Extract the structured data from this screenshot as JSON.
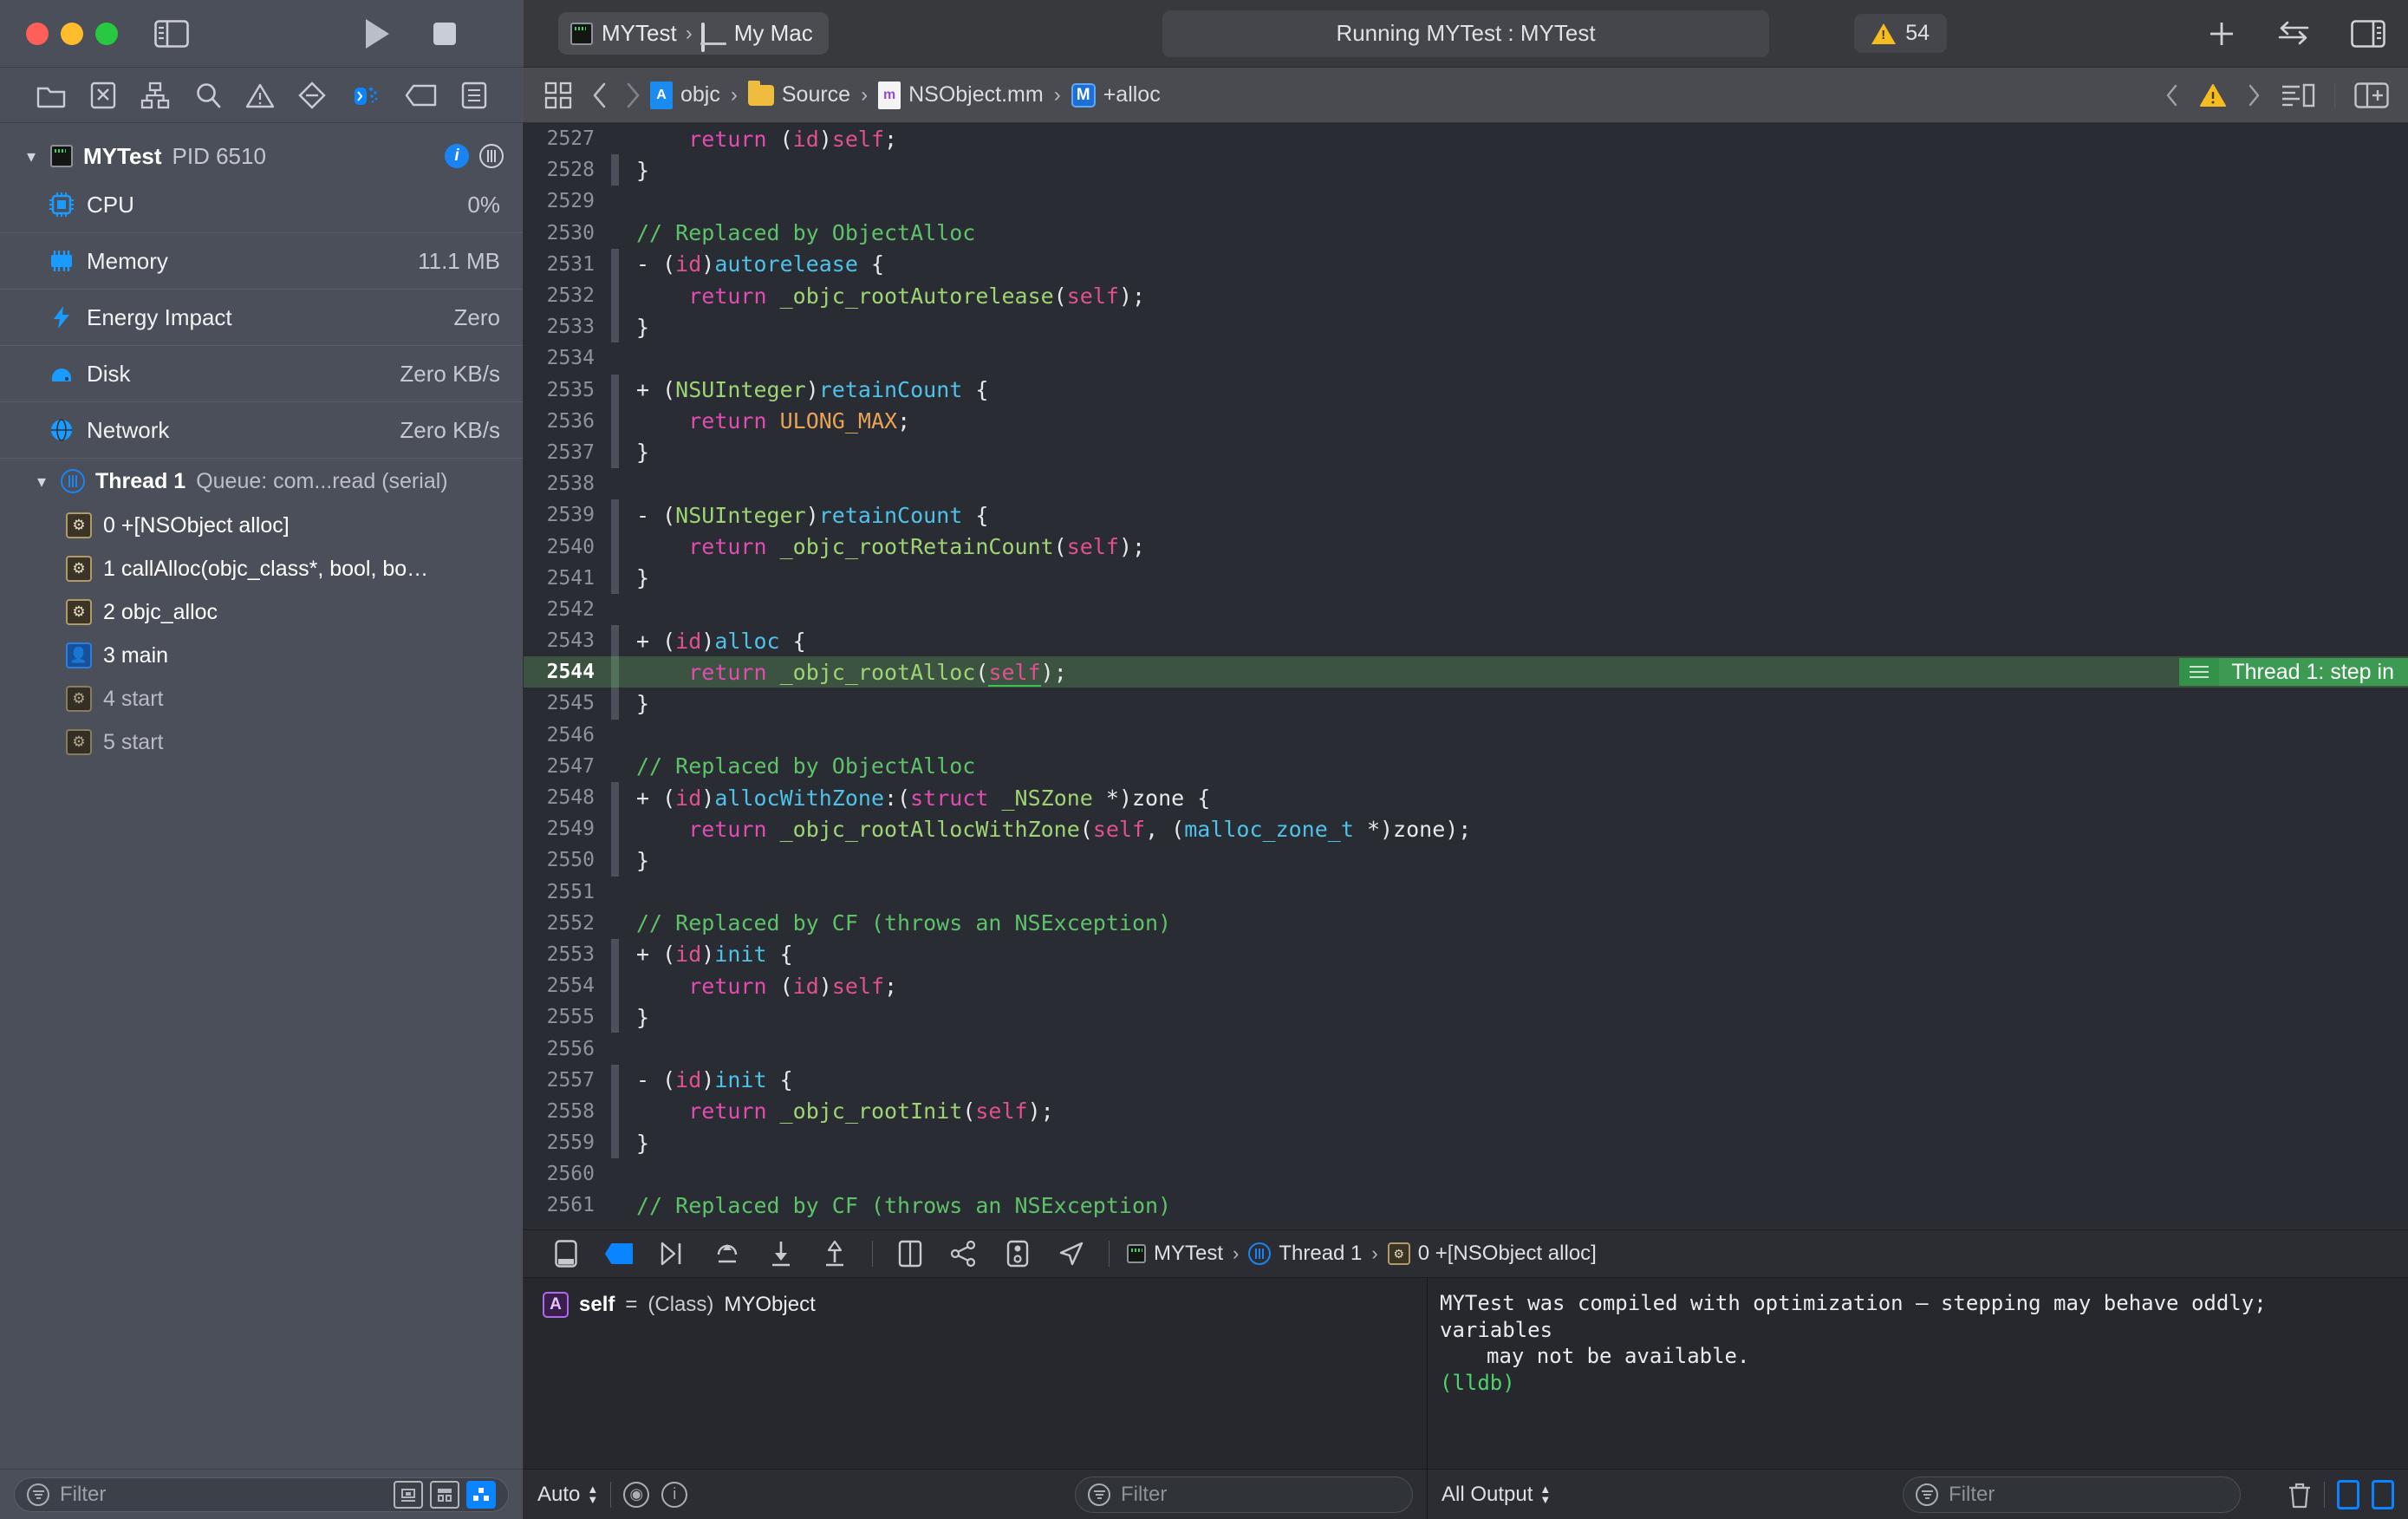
{
  "window": {
    "traffic_lights": [
      "close",
      "minimize",
      "zoom"
    ],
    "run_button": "run-icon",
    "stop_button": "stop-icon"
  },
  "scheme": {
    "target": "MYTest",
    "separator": "›",
    "destination": "My Mac"
  },
  "status": {
    "text": "Running MYTest : MYTest",
    "warning_count": "54"
  },
  "toolbar_right": {
    "add": "plus-icon",
    "navigate": "swap-icon",
    "inspector": "inspector-toggle-icon"
  },
  "navigator_toolbar": {
    "items": [
      {
        "name": "folder-icon",
        "label": "Project navigator"
      },
      {
        "name": "source-control-icon",
        "label": "Source control navigator"
      },
      {
        "name": "hierarchy-icon",
        "label": "Symbol navigator"
      },
      {
        "name": "search-icon",
        "label": "Find navigator"
      },
      {
        "name": "warning-icon",
        "label": "Issue navigator"
      },
      {
        "name": "test-icon",
        "label": "Test navigator"
      },
      {
        "name": "debug-icon",
        "label": "Debug navigator"
      },
      {
        "name": "breakpoint-icon",
        "label": "Breakpoint navigator"
      },
      {
        "name": "report-icon",
        "label": "Report navigator"
      }
    ]
  },
  "jump_bar": {
    "separator": "›",
    "crumbs": [
      {
        "label": "objc",
        "icon": "project-icon"
      },
      {
        "label": "Source",
        "icon": "folder-icon"
      },
      {
        "label": "NSObject.mm",
        "icon": "objcpp-file-icon"
      },
      {
        "label": "+alloc",
        "icon": "method-badge-icon"
      }
    ]
  },
  "debug_navigator": {
    "process": {
      "name": "MYTest",
      "pid": "PID 6510"
    },
    "gauges": [
      {
        "label": "CPU",
        "value": "0%",
        "icon": "cpu-icon"
      },
      {
        "label": "Memory",
        "value": "11.1 MB",
        "icon": "memory-icon"
      },
      {
        "label": "Energy Impact",
        "value": "Zero",
        "icon": "energy-icon"
      },
      {
        "label": "Disk",
        "value": "Zero KB/s",
        "icon": "disk-icon"
      },
      {
        "label": "Network",
        "value": "Zero KB/s",
        "icon": "network-icon"
      }
    ],
    "thread": {
      "name": "Thread 1",
      "queue": "Queue: com...read (serial)"
    },
    "frames": [
      {
        "label": "0 +[NSObject alloc]",
        "kind": "system",
        "dim": false
      },
      {
        "label": "1 callAlloc(objc_class*, bool, bo…",
        "kind": "system",
        "dim": false
      },
      {
        "label": "2 objc_alloc",
        "kind": "system",
        "dim": false
      },
      {
        "label": "3 main",
        "kind": "user",
        "dim": false
      },
      {
        "label": "4 start",
        "kind": "system",
        "dim": true
      },
      {
        "label": "5 start",
        "kind": "system",
        "dim": true
      }
    ],
    "filter_placeholder": "Filter"
  },
  "editor": {
    "highlight_line": 2544,
    "step_badge": "Thread 1: step in",
    "lines": [
      {
        "n": 2527,
        "mark": false,
        "tokens": [
          {
            "t": "    ",
            "c": "plain"
          },
          {
            "t": "return",
            "c": "kw"
          },
          {
            "t": " (",
            "c": "plain"
          },
          {
            "t": "id",
            "c": "self"
          },
          {
            "t": ")",
            "c": "plain"
          },
          {
            "t": "self",
            "c": "self"
          },
          {
            "t": ";",
            "c": "plain"
          }
        ]
      },
      {
        "n": 2528,
        "mark": true,
        "tokens": [
          {
            "t": "}",
            "c": "plain"
          }
        ]
      },
      {
        "n": 2529,
        "mark": false,
        "tokens": []
      },
      {
        "n": 2530,
        "mark": false,
        "tokens": [
          {
            "t": "// Replaced by ObjectAlloc",
            "c": "cmt"
          }
        ]
      },
      {
        "n": 2531,
        "mark": true,
        "tokens": [
          {
            "t": "- (",
            "c": "plain"
          },
          {
            "t": "id",
            "c": "self"
          },
          {
            "t": ")",
            "c": "plain"
          },
          {
            "t": "autorelease",
            "c": "meth"
          },
          {
            "t": " {",
            "c": "plain"
          }
        ]
      },
      {
        "n": 2532,
        "mark": true,
        "tokens": [
          {
            "t": "    ",
            "c": "plain"
          },
          {
            "t": "return",
            "c": "kw"
          },
          {
            "t": " ",
            "c": "plain"
          },
          {
            "t": "_objc_rootAutorelease",
            "c": "fn"
          },
          {
            "t": "(",
            "c": "plain"
          },
          {
            "t": "self",
            "c": "self"
          },
          {
            "t": ");",
            "c": "plain"
          }
        ]
      },
      {
        "n": 2533,
        "mark": true,
        "tokens": [
          {
            "t": "}",
            "c": "plain"
          }
        ]
      },
      {
        "n": 2534,
        "mark": false,
        "tokens": []
      },
      {
        "n": 2535,
        "mark": true,
        "tokens": [
          {
            "t": "+ (",
            "c": "plain"
          },
          {
            "t": "NSUInteger",
            "c": "type"
          },
          {
            "t": ")",
            "c": "plain"
          },
          {
            "t": "retainCount",
            "c": "meth"
          },
          {
            "t": " {",
            "c": "plain"
          }
        ]
      },
      {
        "n": 2536,
        "mark": true,
        "tokens": [
          {
            "t": "    ",
            "c": "plain"
          },
          {
            "t": "return",
            "c": "kw"
          },
          {
            "t": " ",
            "c": "plain"
          },
          {
            "t": "ULONG_MAX",
            "c": "macro"
          },
          {
            "t": ";",
            "c": "plain"
          }
        ]
      },
      {
        "n": 2537,
        "mark": true,
        "tokens": [
          {
            "t": "}",
            "c": "plain"
          }
        ]
      },
      {
        "n": 2538,
        "mark": false,
        "tokens": []
      },
      {
        "n": 2539,
        "mark": true,
        "tokens": [
          {
            "t": "- (",
            "c": "plain"
          },
          {
            "t": "NSUInteger",
            "c": "type"
          },
          {
            "t": ")",
            "c": "plain"
          },
          {
            "t": "retainCount",
            "c": "meth"
          },
          {
            "t": " {",
            "c": "plain"
          }
        ]
      },
      {
        "n": 2540,
        "mark": true,
        "tokens": [
          {
            "t": "    ",
            "c": "plain"
          },
          {
            "t": "return",
            "c": "kw"
          },
          {
            "t": " ",
            "c": "plain"
          },
          {
            "t": "_objc_rootRetainCount",
            "c": "fn"
          },
          {
            "t": "(",
            "c": "plain"
          },
          {
            "t": "self",
            "c": "self"
          },
          {
            "t": ");",
            "c": "plain"
          }
        ]
      },
      {
        "n": 2541,
        "mark": true,
        "tokens": [
          {
            "t": "}",
            "c": "plain"
          }
        ]
      },
      {
        "n": 2542,
        "mark": false,
        "tokens": []
      },
      {
        "n": 2543,
        "mark": true,
        "tokens": [
          {
            "t": "+ (",
            "c": "plain"
          },
          {
            "t": "id",
            "c": "self"
          },
          {
            "t": ")",
            "c": "plain"
          },
          {
            "t": "alloc",
            "c": "meth"
          },
          {
            "t": " {",
            "c": "plain"
          }
        ]
      },
      {
        "n": 2544,
        "mark": true,
        "tokens": [
          {
            "t": "    ",
            "c": "plain"
          },
          {
            "t": "return",
            "c": "kw"
          },
          {
            "t": " ",
            "c": "plain"
          },
          {
            "t": "_objc_rootAlloc",
            "c": "fn"
          },
          {
            "t": "(",
            "c": "plain"
          },
          {
            "t": "self",
            "c": "uself"
          },
          {
            "t": ");",
            "c": "plain"
          }
        ]
      },
      {
        "n": 2545,
        "mark": true,
        "tokens": [
          {
            "t": "}",
            "c": "plain"
          }
        ]
      },
      {
        "n": 2546,
        "mark": false,
        "tokens": []
      },
      {
        "n": 2547,
        "mark": false,
        "tokens": [
          {
            "t": "// Replaced by ObjectAlloc",
            "c": "cmt"
          }
        ]
      },
      {
        "n": 2548,
        "mark": true,
        "tokens": [
          {
            "t": "+ (",
            "c": "plain"
          },
          {
            "t": "id",
            "c": "self"
          },
          {
            "t": ")",
            "c": "plain"
          },
          {
            "t": "allocWithZone",
            "c": "meth"
          },
          {
            "t": ":(",
            "c": "plain"
          },
          {
            "t": "struct",
            "c": "kw"
          },
          {
            "t": " ",
            "c": "plain"
          },
          {
            "t": "_NSZone",
            "c": "type"
          },
          {
            "t": " *)zone {",
            "c": "plain"
          }
        ]
      },
      {
        "n": 2549,
        "mark": true,
        "tokens": [
          {
            "t": "    ",
            "c": "plain"
          },
          {
            "t": "return",
            "c": "kw"
          },
          {
            "t": " ",
            "c": "plain"
          },
          {
            "t": "_objc_rootAllocWithZone",
            "c": "fn"
          },
          {
            "t": "(",
            "c": "plain"
          },
          {
            "t": "self",
            "c": "self"
          },
          {
            "t": ", (",
            "c": "plain"
          },
          {
            "t": "malloc_zone_t",
            "c": "meth"
          },
          {
            "t": " *)zone);",
            "c": "plain"
          }
        ]
      },
      {
        "n": 2550,
        "mark": true,
        "tokens": [
          {
            "t": "}",
            "c": "plain"
          }
        ]
      },
      {
        "n": 2551,
        "mark": false,
        "tokens": []
      },
      {
        "n": 2552,
        "mark": false,
        "tokens": [
          {
            "t": "// Replaced by CF (throws an NSException)",
            "c": "cmt"
          }
        ]
      },
      {
        "n": 2553,
        "mark": true,
        "tokens": [
          {
            "t": "+ (",
            "c": "plain"
          },
          {
            "t": "id",
            "c": "self"
          },
          {
            "t": ")",
            "c": "plain"
          },
          {
            "t": "init",
            "c": "meth"
          },
          {
            "t": " {",
            "c": "plain"
          }
        ]
      },
      {
        "n": 2554,
        "mark": true,
        "tokens": [
          {
            "t": "    ",
            "c": "plain"
          },
          {
            "t": "return",
            "c": "kw"
          },
          {
            "t": " (",
            "c": "plain"
          },
          {
            "t": "id",
            "c": "self"
          },
          {
            "t": ")",
            "c": "plain"
          },
          {
            "t": "self",
            "c": "self"
          },
          {
            "t": ";",
            "c": "plain"
          }
        ]
      },
      {
        "n": 2555,
        "mark": true,
        "tokens": [
          {
            "t": "}",
            "c": "plain"
          }
        ]
      },
      {
        "n": 2556,
        "mark": false,
        "tokens": []
      },
      {
        "n": 2557,
        "mark": true,
        "tokens": [
          {
            "t": "- (",
            "c": "plain"
          },
          {
            "t": "id",
            "c": "self"
          },
          {
            "t": ")",
            "c": "plain"
          },
          {
            "t": "init",
            "c": "meth"
          },
          {
            "t": " {",
            "c": "plain"
          }
        ]
      },
      {
        "n": 2558,
        "mark": true,
        "tokens": [
          {
            "t": "    ",
            "c": "plain"
          },
          {
            "t": "return",
            "c": "kw"
          },
          {
            "t": " ",
            "c": "plain"
          },
          {
            "t": "_objc_rootInit",
            "c": "fn"
          },
          {
            "t": "(",
            "c": "plain"
          },
          {
            "t": "self",
            "c": "self"
          },
          {
            "t": ");",
            "c": "plain"
          }
        ]
      },
      {
        "n": 2559,
        "mark": true,
        "tokens": [
          {
            "t": "}",
            "c": "plain"
          }
        ]
      },
      {
        "n": 2560,
        "mark": false,
        "tokens": []
      },
      {
        "n": 2561,
        "mark": false,
        "tokens": [
          {
            "t": "// Replaced by CF (throws an NSException)",
            "c": "cmt"
          }
        ]
      }
    ]
  },
  "debug_bar": {
    "icons": [
      {
        "name": "hide-debug-area-icon"
      },
      {
        "name": "breakpoint-activate-icon"
      },
      {
        "name": "continue-icon"
      },
      {
        "name": "step-over-icon"
      },
      {
        "name": "step-into-icon"
      },
      {
        "name": "step-out-icon"
      },
      {
        "name": "view-debugger-icon"
      },
      {
        "name": "memory-graph-icon"
      },
      {
        "name": "environment-overrides-icon"
      },
      {
        "name": "location-simulate-icon"
      }
    ],
    "separator": "›",
    "crumbs": [
      {
        "label": "MYTest",
        "icon": "app-icon"
      },
      {
        "label": "Thread 1",
        "icon": "thread-icon"
      },
      {
        "label": "0 +[NSObject alloc]",
        "icon": "frame-icon"
      }
    ]
  },
  "variables": {
    "rows": [
      {
        "badge": "A",
        "name": "self",
        "eq": "=",
        "type": "(Class)",
        "value": "MYObject"
      }
    ],
    "scope_label": "Auto",
    "filter_placeholder": "Filter",
    "eye_icon": "eye-icon",
    "info_icon": "info-icon"
  },
  "console": {
    "lines": [
      {
        "text": "MYTest was compiled with optimization — stepping may behave oddly; variables",
        "style": "normal"
      },
      {
        "text": "may not be available.",
        "style": "indent"
      },
      {
        "text": "(lldb)",
        "style": "lldb"
      }
    ],
    "output_filter_label": "All Output",
    "filter_placeholder": "Filter",
    "clear_icon": "trash-icon"
  }
}
